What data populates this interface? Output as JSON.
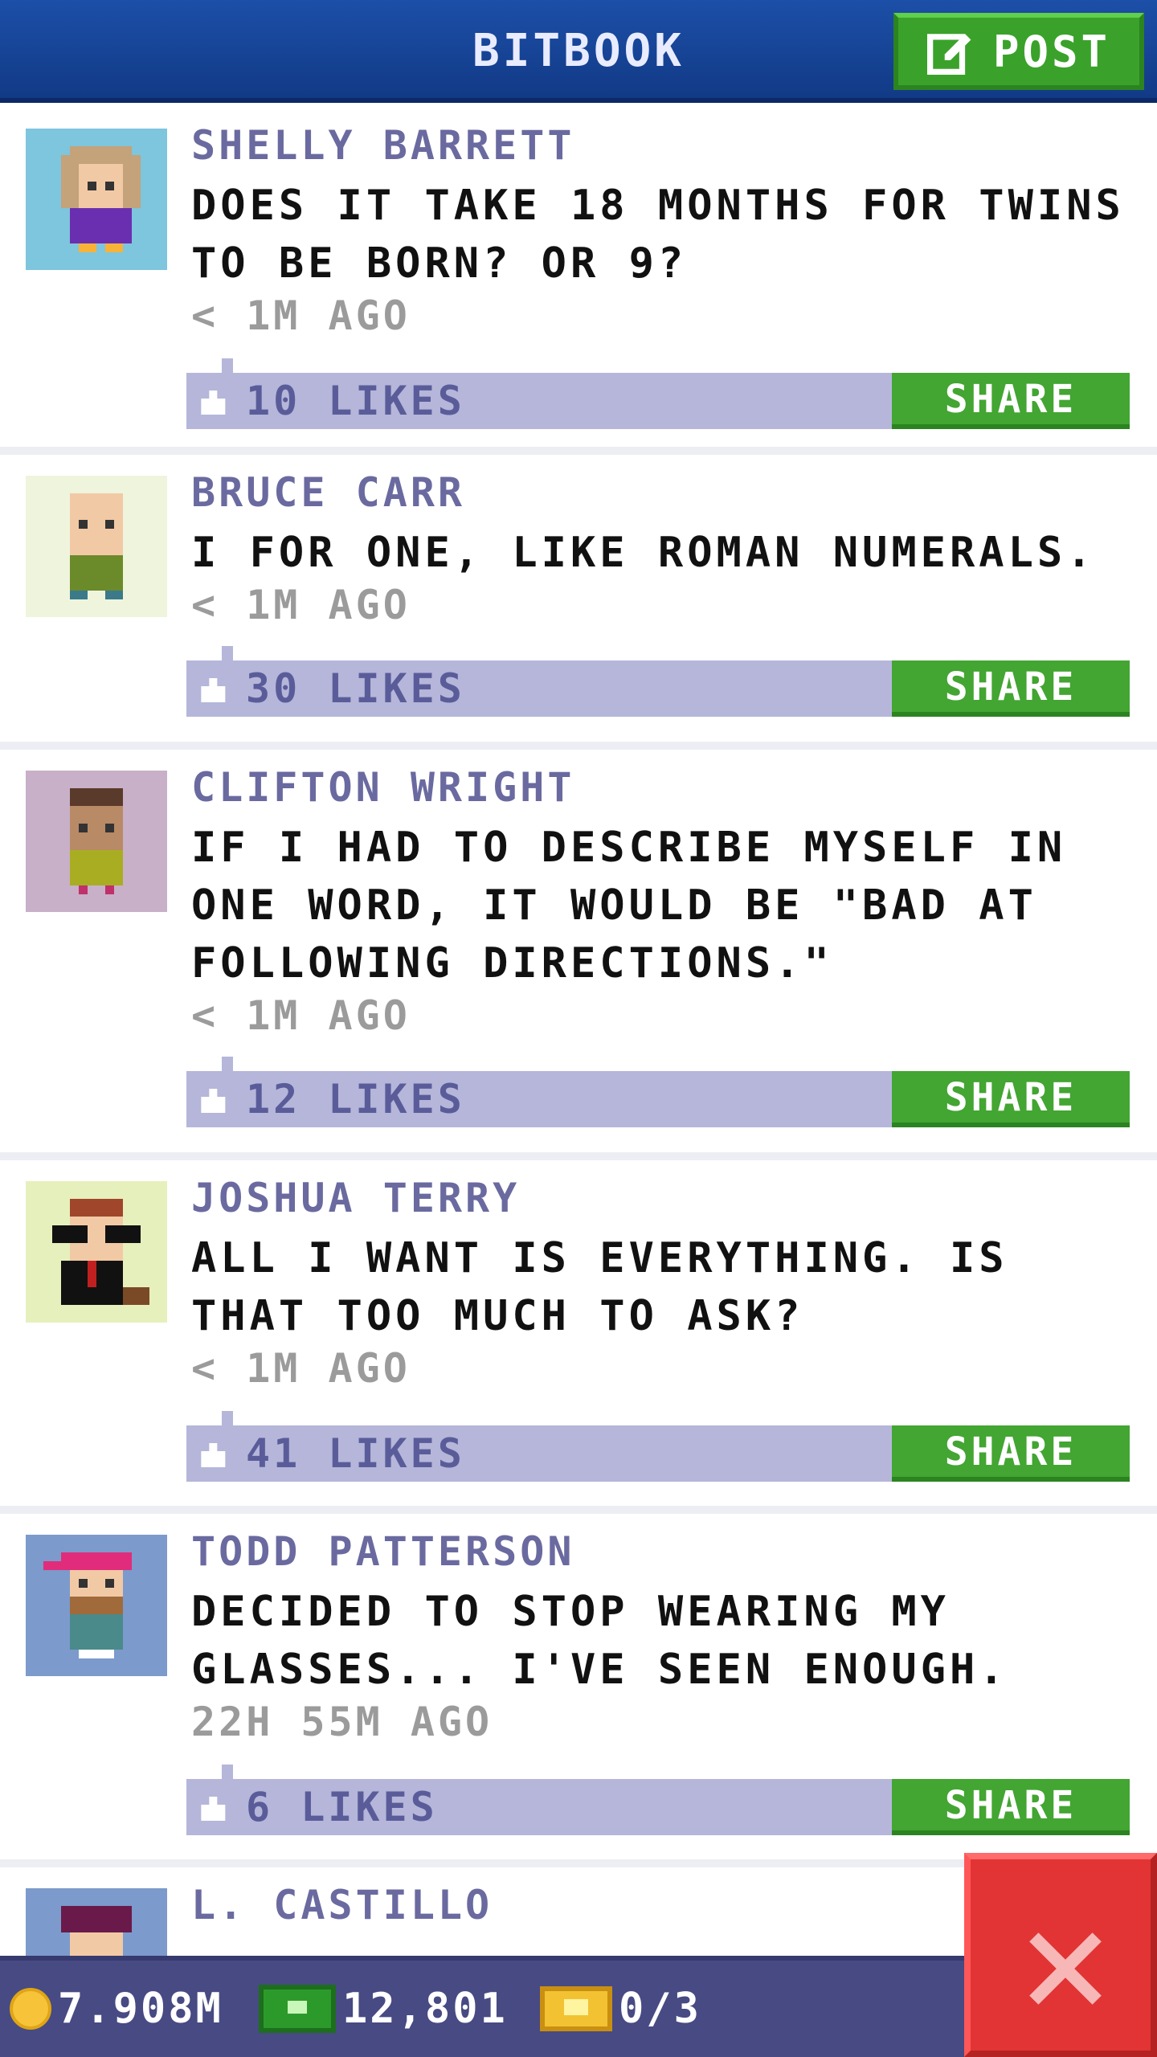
{
  "header": {
    "title": "BITBOOK",
    "post_label": "POST"
  },
  "posts": [
    {
      "author": "SHELLY BARRETT",
      "message": "DOES IT TAKE 18 MONTHS FOR TWINS TO BE BORN? OR 9?",
      "time": "< 1M AGO",
      "likes": "10 LIKES",
      "share_label": "SHARE"
    },
    {
      "author": "BRUCE CARR",
      "message": "I FOR ONE, LIKE ROMAN NUMERALS.",
      "time": "< 1M AGO",
      "likes": "30 LIKES",
      "share_label": "SHARE"
    },
    {
      "author": "CLIFTON WRIGHT",
      "message": "IF I HAD TO DESCRIBE MYSELF IN ONE WORD, IT WOULD BE \"BAD AT FOLLOWING DIRECTIONS.\"",
      "time": "< 1M AGO",
      "likes": "12 LIKES",
      "share_label": "SHARE"
    },
    {
      "author": "JOSHUA TERRY",
      "message": "ALL I WANT IS EVERYTHING. IS THAT TOO MUCH TO ASK?",
      "time": "< 1M AGO",
      "likes": "41 LIKES",
      "share_label": "SHARE"
    },
    {
      "author": "TODD PATTERSON",
      "message": "DECIDED TO STOP WEARING MY GLASSES... I'VE SEEN ENOUGH.",
      "time": "22H 55M AGO",
      "likes": "6 LIKES",
      "share_label": "SHARE"
    },
    {
      "author": "L. CASTILLO"
    }
  ],
  "status": {
    "coins": "7.908M",
    "bux": "12,801",
    "tickets": "0/3"
  },
  "icons": {
    "post": "edit-icon",
    "like": "thumbs-up-icon",
    "coin": "coin-icon",
    "bux": "cash-icon",
    "ticket": "ticket-icon",
    "close": "close-icon"
  },
  "colors": {
    "header": "#1c4fa8",
    "accent_green": "#43a532",
    "like_bar": "#b5b6d9",
    "author_text": "#6a6aa0",
    "close_red": "#e23434"
  }
}
